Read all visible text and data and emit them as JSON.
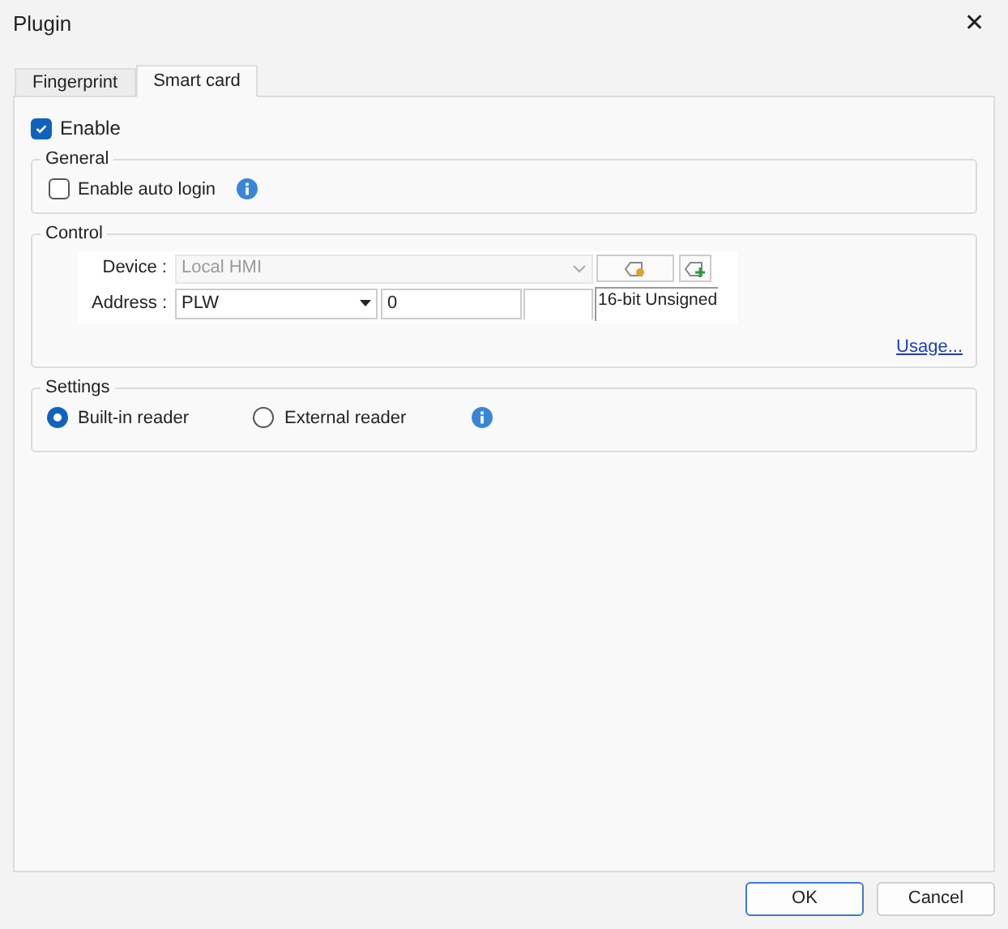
{
  "window": {
    "title": "Plugin",
    "close": "✕"
  },
  "tabs": [
    {
      "label": "Fingerprint",
      "selected": false
    },
    {
      "label": "Smart card",
      "selected": true
    }
  ],
  "enable": {
    "label": "Enable",
    "checked": true
  },
  "general": {
    "title": "General",
    "auto_login": {
      "label": "Enable auto login",
      "checked": false
    }
  },
  "control": {
    "title": "Control",
    "device": {
      "label": "Device :",
      "value": "Local HMI",
      "disabled": true
    },
    "address": {
      "label": "Address :",
      "type": "PLW",
      "value": "0",
      "data_type": "16-bit Unsigned"
    },
    "usage_link": "Usage..."
  },
  "settings": {
    "title": "Settings",
    "readers": [
      {
        "label": "Built-in reader",
        "selected": true
      },
      {
        "label": "External reader",
        "selected": false
      }
    ]
  },
  "buttons": [
    {
      "label": "OK",
      "default": true
    },
    {
      "label": "Cancel",
      "default": false
    }
  ]
}
